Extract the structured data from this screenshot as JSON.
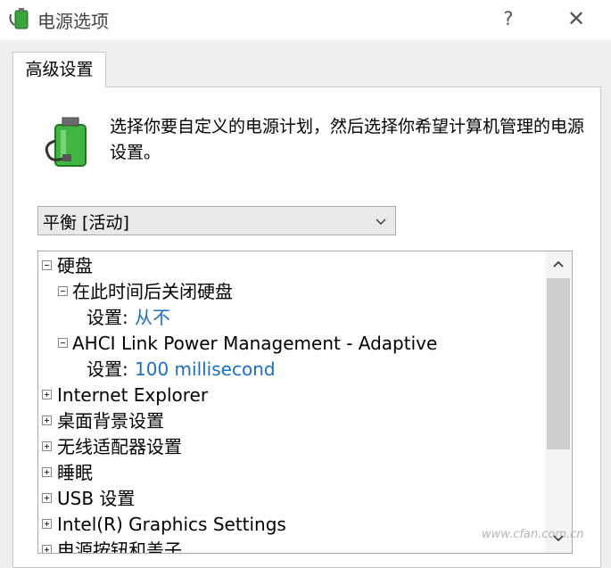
{
  "window": {
    "title": "电源选项",
    "help_label": "?",
    "close_label": "✕"
  },
  "tab": {
    "label": "高级设置"
  },
  "description": {
    "text": "选择你要自定义的电源计划，然后选择你希望计算机管理的电源设置。"
  },
  "plan_select": {
    "value": "平衡 [活动]"
  },
  "tree": {
    "items": [
      {
        "label": "硬盘",
        "state": "expanded"
      },
      {
        "label": "在此时间后关闭硬盘",
        "state": "expanded"
      },
      {
        "setting_label": "设置:",
        "setting_value": "从不"
      },
      {
        "label": "AHCI Link Power Management - Adaptive",
        "state": "expanded"
      },
      {
        "setting_label": "设置:",
        "setting_value": "100 millisecond"
      },
      {
        "label": "Internet Explorer",
        "state": "collapsed"
      },
      {
        "label": "桌面背景设置",
        "state": "collapsed"
      },
      {
        "label": "无线适配器设置",
        "state": "collapsed"
      },
      {
        "label": "睡眠",
        "state": "collapsed"
      },
      {
        "label": "USB 设置",
        "state": "collapsed"
      },
      {
        "label": "Intel(R) Graphics Settings",
        "state": "collapsed"
      },
      {
        "label": "电源按钮和盖子",
        "state": "collapsed"
      }
    ]
  },
  "watermark": {
    "text": "www.cfan.com.cn"
  },
  "colors": {
    "value_blue": "#1a6fc4",
    "panel_bg": "#ffffff",
    "window_bg": "#f0f0f0"
  }
}
